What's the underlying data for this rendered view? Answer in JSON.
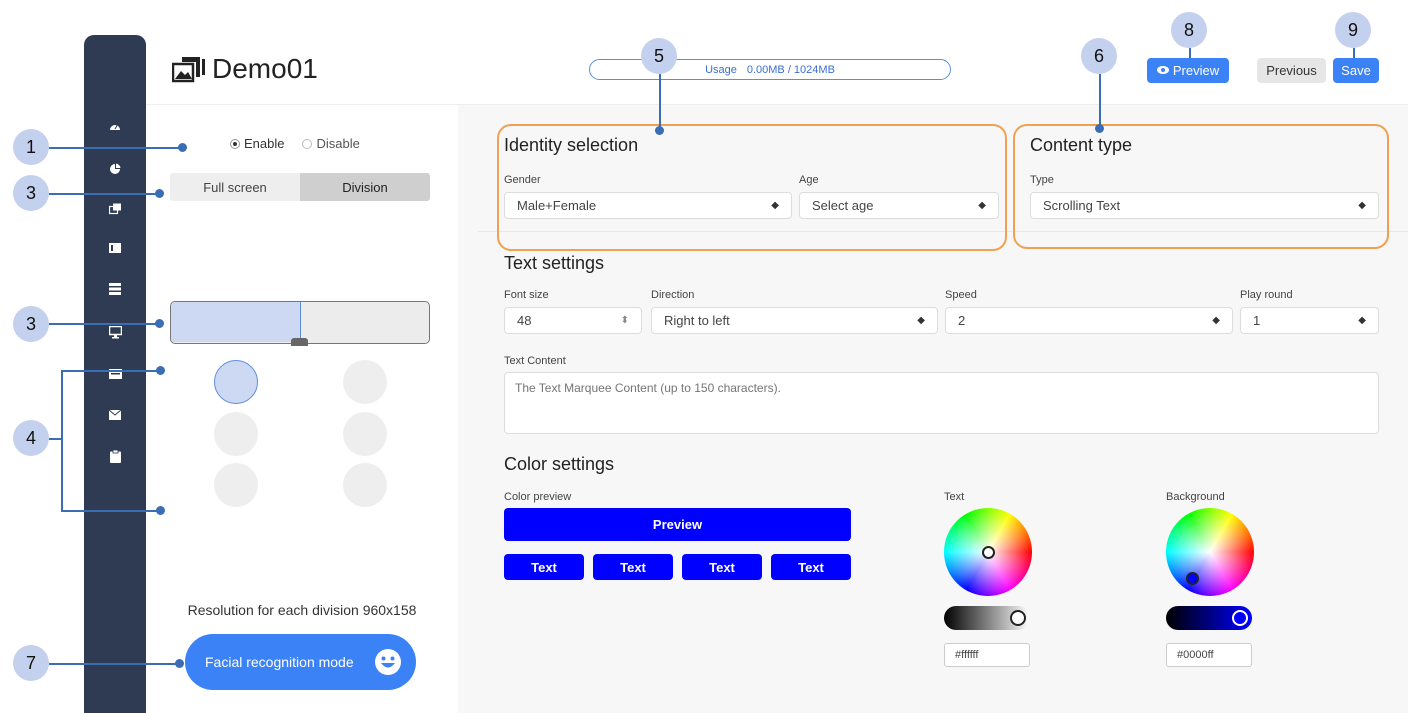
{
  "header": {
    "title": "Demo01",
    "usage_label": "Usage",
    "usage_value": "0.00MB / 1024MB",
    "preview_button": "Preview",
    "previous_button": "Previous",
    "save_button": "Save"
  },
  "sidebar": {
    "icons": [
      "dashboard-icon",
      "pie-chart-icon",
      "media-icon",
      "list-icon",
      "server-icon",
      "monitor-icon",
      "card-icon",
      "mail-icon",
      "clipboard-icon"
    ]
  },
  "left": {
    "enable_label": "Enable",
    "disable_label": "Disable",
    "mode_full": "Full screen",
    "mode_division": "Division",
    "resolution_text": "Resolution for each division 960x158",
    "facial_button": "Facial recognition mode"
  },
  "identity": {
    "title": "Identity selection",
    "gender_label": "Gender",
    "gender_value": "Male+Female",
    "age_label": "Age",
    "age_value": "Select age"
  },
  "content_type": {
    "title": "Content type",
    "type_label": "Type",
    "type_value": "Scrolling Text"
  },
  "text_settings": {
    "title": "Text settings",
    "font_size_label": "Font size",
    "font_size_value": "48",
    "direction_label": "Direction",
    "direction_value": "Right to left",
    "speed_label": "Speed",
    "speed_value": "2",
    "play_round_label": "Play round",
    "play_round_value": "1",
    "content_label": "Text Content",
    "content_placeholder": "The Text Marquee Content (up to 150 characters)."
  },
  "color_settings": {
    "title": "Color settings",
    "preview_label": "Color preview",
    "preview_button": "Preview",
    "text_buttons": [
      "Text",
      "Text",
      "Text",
      "Text"
    ],
    "text_label": "Text",
    "text_hex": "#ffffff",
    "background_label": "Background",
    "background_hex": "#0000ff",
    "colors": {
      "preview_blue": "#0000ff",
      "accent": "#3b82f6",
      "callout_line": "#3a6db3",
      "highlight_box": "#f0a050"
    }
  },
  "callouts": [
    "1",
    "3",
    "3",
    "4",
    "5",
    "6",
    "7",
    "8",
    "9"
  ]
}
